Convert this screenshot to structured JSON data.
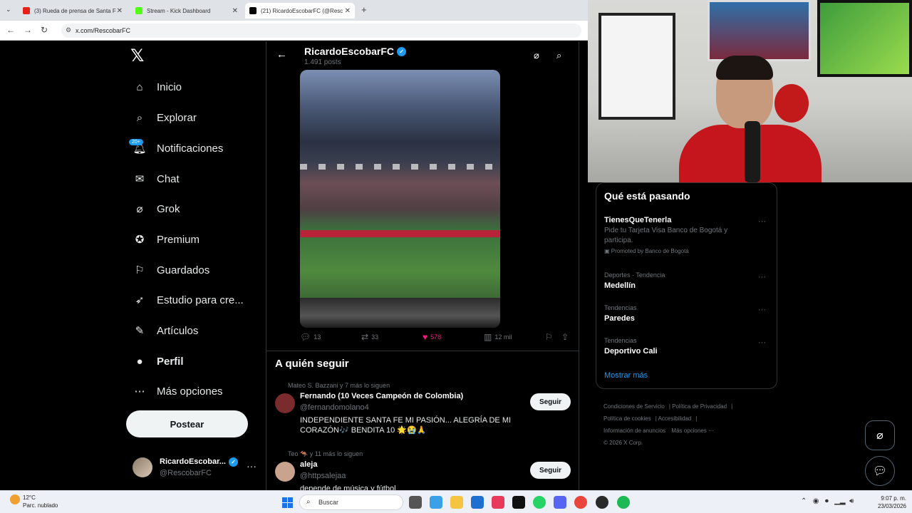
{
  "browser": {
    "tabs": [
      {
        "label": "(3) Rueda de prensa de Santa F",
        "favicon_color": "#e62117",
        "active": false
      },
      {
        "label": "Stream - Kick Dashboard",
        "favicon_color": "#53fc18",
        "active": false
      },
      {
        "label": "(21) RicardoEscobarFC (@Resc",
        "favicon_color": "#000000",
        "active": true
      }
    ],
    "new_tab": "+",
    "url": "x.com/RescobarFC"
  },
  "sidebar": {
    "logo": "𝕏",
    "items": [
      {
        "label": "Inicio",
        "icon": "home-icon",
        "glyph": "⌂"
      },
      {
        "label": "Explorar",
        "icon": "search-icon",
        "glyph": "⌕"
      },
      {
        "label": "Notificaciones",
        "icon": "bell-icon",
        "glyph": "🔔︎"
      },
      {
        "label": "Chat",
        "icon": "mail-icon",
        "glyph": "✉"
      },
      {
        "label": "Grok",
        "icon": "grok-icon",
        "glyph": "⌀"
      },
      {
        "label": "Premium",
        "icon": "premium-icon",
        "glyph": "✪"
      },
      {
        "label": "Guardados",
        "icon": "bookmark-icon",
        "glyph": "⚐"
      },
      {
        "label": "Estudio para cre...",
        "icon": "rocket-icon",
        "glyph": "➶"
      },
      {
        "label": "Artículos",
        "icon": "article-icon",
        "glyph": "✎"
      },
      {
        "label": "Perfil",
        "icon": "person-icon",
        "glyph": "●"
      },
      {
        "label": "Más opciones",
        "icon": "more-circle-icon",
        "glyph": "⋯"
      }
    ],
    "notif_badge": "20+",
    "post_button": "Postear",
    "account": {
      "name": "RicardoEscobar...",
      "handle": "@RescobarFC",
      "more": "···"
    }
  },
  "header": {
    "back": "←",
    "name": "RicardoEscobarFC",
    "post_count": "1.491 posts"
  },
  "tweet_actions": {
    "replies": "13",
    "retweets": "33",
    "likes": "578",
    "views": "12 mil"
  },
  "who_to_follow": {
    "title": "A quién seguir",
    "accounts": [
      {
        "context": "Mateo S. Bazzani y 7 más lo siguen",
        "name": "Fernando (10 Veces Campeón de Colombia)",
        "handle": "@fernandomolano4",
        "bio": "INDEPENDIENTE SANTA FE MI PASIÓN... ALEGRÍA DE MI CORAZÓN🎶 BENDITA 10 🌟😭🙏",
        "button": "Seguir",
        "avatar_color": "#7a2b2b"
      },
      {
        "context": "Teo 🦘 y 11 más lo siguen",
        "name": "aleja",
        "handle": "@httpsalejaa",
        "bio": "depende de música y fútbol",
        "button": "Seguir",
        "avatar_color": "#c9a38e"
      }
    ]
  },
  "trends": {
    "title": "Qué está pasando",
    "items": [
      {
        "meta": "",
        "name": "TienesQueTenerla",
        "desc": "Pide tu Tarjeta Visa Banco de Bogotá y participa.",
        "promo": "Promoted by Banco de Bogotá"
      },
      {
        "meta": "Deportes · Tendencia",
        "name": "Medellín"
      },
      {
        "meta": "Tendencias",
        "name": "Paredes"
      },
      {
        "meta": "Tendencias",
        "name": "Deportivo Cali"
      }
    ],
    "more_dots": "···",
    "show_more": "Mostrar más"
  },
  "footer": {
    "links": [
      "Condiciones de Servicio",
      "Política de Privacidad",
      "Política de cookies",
      "Accesibilidad",
      "Información de anuncios",
      "Más opciones ···"
    ],
    "copyright": "© 2026 X Corp."
  },
  "taskbar": {
    "temp": "12°C",
    "weather": "Parc. nublado",
    "search": "Buscar",
    "time": "9:07 p. m.",
    "date": "23/03/2026"
  },
  "colors": {
    "accent": "#1d9bf0",
    "like": "#f91880",
    "background": "#000000"
  }
}
